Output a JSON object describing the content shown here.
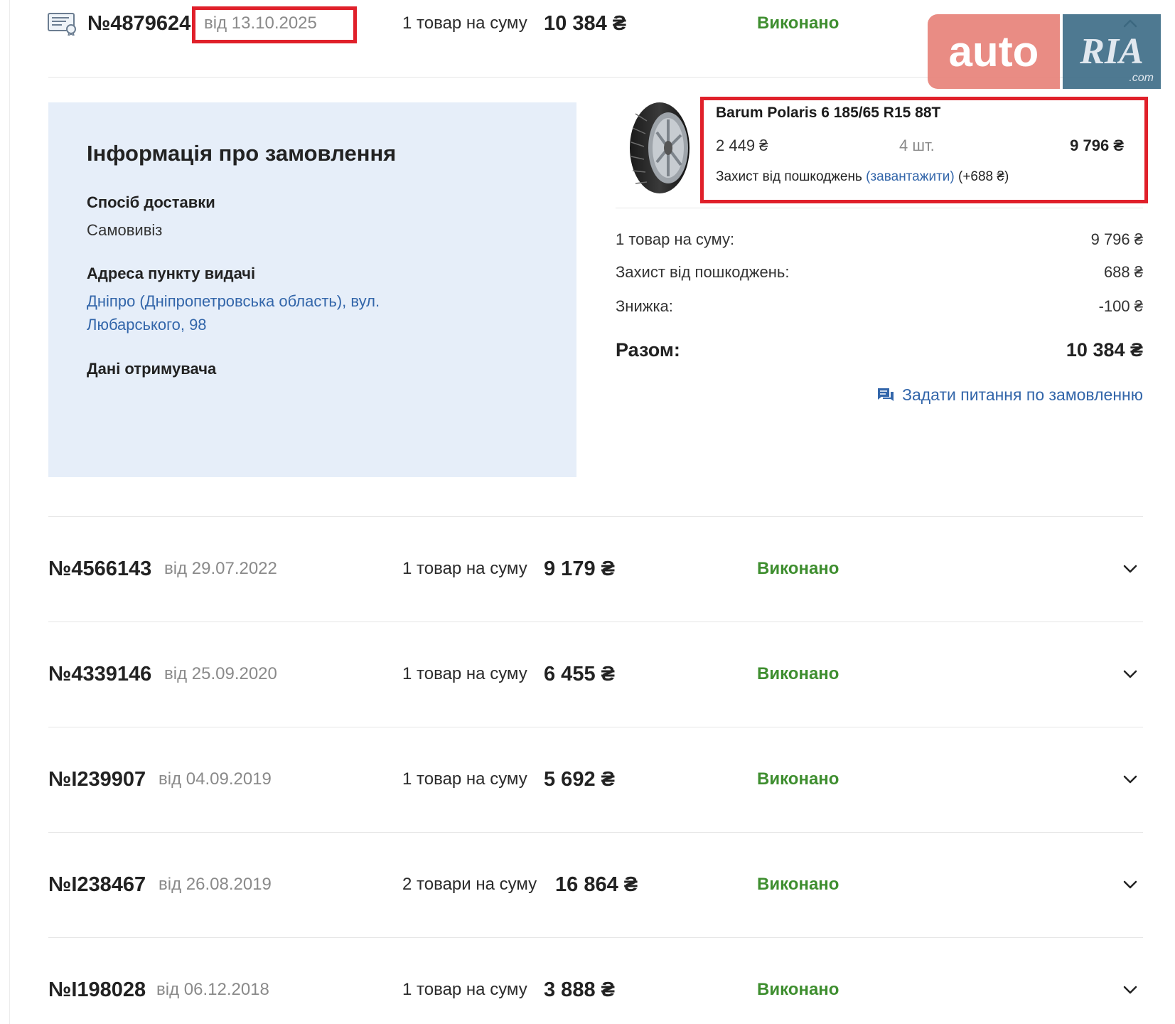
{
  "orders": [
    {
      "number": "№4879624",
      "date": "від 13.10.2025",
      "count_text": "1 товар на суму",
      "sum": "10 384 ₴",
      "status": "Виконано"
    },
    {
      "number": "№4566143",
      "date": "від 29.07.2022",
      "count_text": "1 товар на суму",
      "sum": "9 179 ₴",
      "status": "Виконано"
    },
    {
      "number": "№4339146",
      "date": "від 25.09.2020",
      "count_text": "1 товар на суму",
      "sum": "6 455 ₴",
      "status": "Виконано"
    },
    {
      "number": "№I239907",
      "date": "від 04.09.2019",
      "count_text": "1 товар на суму",
      "sum": "5 692 ₴",
      "status": "Виконано"
    },
    {
      "number": "№I238467",
      "date": "від 26.08.2019",
      "count_text": "2 товари на суму",
      "sum": "16 864 ₴",
      "status": "Виконано"
    },
    {
      "number": "№I198028",
      "date": "від 06.12.2018",
      "count_text": "1 товар на суму",
      "sum": "3 888 ₴",
      "status": "Виконано"
    }
  ],
  "info": {
    "title": "Інформація про замовлення",
    "delivery_label": "Спосіб доставки",
    "delivery_value": "Самовивіз",
    "address_label": "Адреса пункту видачі",
    "address_line1": "Дніпро (Дніпропетровська область), вул.",
    "address_line2": "Любарського, 98",
    "recipient_label": "Дані отримувача"
  },
  "product": {
    "name": "Barum Polaris 6 185/65 R15 88T",
    "price": "2 449 ₴",
    "qty": "4 шт.",
    "total": "9 796 ₴",
    "protection_text": "Захист від пошкоджень",
    "protection_link": "(завантажити)",
    "protection_extra": "(+688 ₴)"
  },
  "summary": {
    "items_label": "1 товар на суму:",
    "items_value": "9 796 ₴",
    "protection_label": "Захист від пошкоджень:",
    "protection_value": "688 ₴",
    "discount_label": "Знижка:",
    "discount_value": "-100 ₴",
    "total_label": "Разом:",
    "total_value": "10 384 ₴",
    "ask_link": "Задати питання по замовленню"
  },
  "watermark": {
    "left": "auto",
    "right": "RIA",
    "suffix": ".com"
  },
  "colors": {
    "status": "#3e8e2f",
    "link": "#3366aa",
    "panel": "#e6eef9",
    "highlight": "#e0202a"
  },
  "icons": [
    "certificate-icon",
    "chevron-up-icon",
    "chevron-down-icon",
    "chat-icon",
    "tire-image"
  ]
}
